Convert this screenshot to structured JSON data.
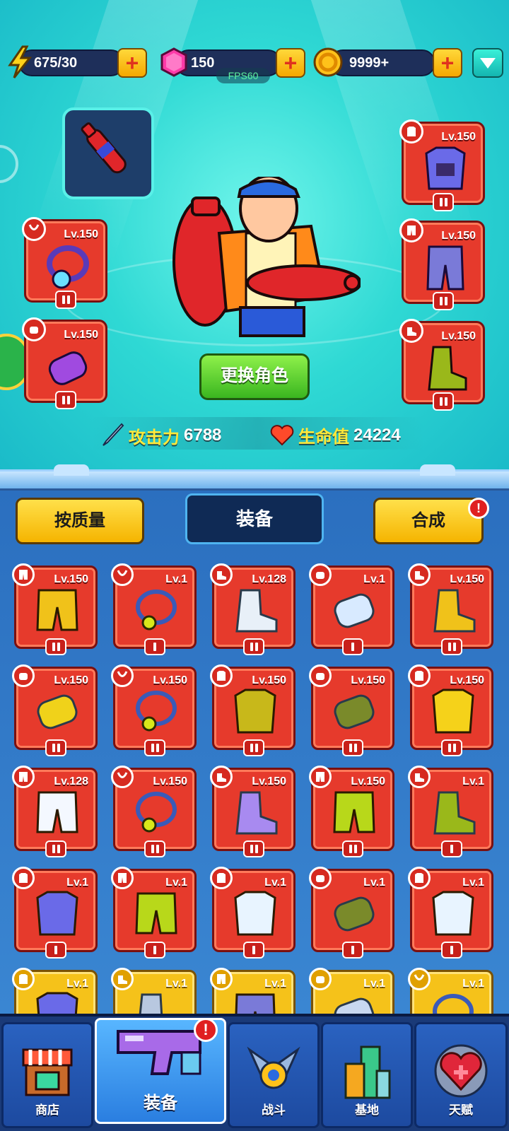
{
  "resources": {
    "energy": "675/30",
    "gems": "150",
    "coins": "9999+",
    "fps": "FPS60"
  },
  "hero_panel": {
    "change_character_label": "更换角色",
    "attack_label": "攻击力",
    "attack_value": "6788",
    "hp_label": "生命值",
    "hp_value": "24224",
    "left_slots": [
      {
        "level": "Lv.150",
        "type": "necklace"
      },
      {
        "level": "Lv.150",
        "type": "glove"
      }
    ],
    "right_slots": [
      {
        "level": "Lv.150",
        "type": "armor"
      },
      {
        "level": "Lv.150",
        "type": "pants"
      },
      {
        "level": "Lv.150",
        "type": "boots"
      }
    ]
  },
  "inventory_header": {
    "sort_label": "按质量",
    "tab_label": "装备",
    "merge_label": "合成",
    "alert": "!"
  },
  "inventory": [
    {
      "level": "Lv.150",
      "type": "pants",
      "item": "yellow-shorts"
    },
    {
      "level": "Lv.1",
      "type": "necklace",
      "item": "blue-necklace"
    },
    {
      "level": "Lv.128",
      "type": "boots",
      "item": "white-sock"
    },
    {
      "level": "Lv.1",
      "type": "glove",
      "item": "white-glove"
    },
    {
      "level": "Lv.150",
      "type": "boots",
      "item": "yellow-slipper"
    },
    {
      "level": "Lv.150",
      "type": "glove",
      "item": "yellow-glove"
    },
    {
      "level": "Lv.150",
      "type": "necklace",
      "item": "tag-necklace"
    },
    {
      "level": "Lv.150",
      "type": "armor",
      "item": "yellow-vest"
    },
    {
      "level": "Lv.150",
      "type": "glove",
      "item": "green-gauntlet"
    },
    {
      "level": "Lv.150",
      "type": "armor",
      "item": "hawaiian-shirt"
    },
    {
      "level": "Lv.128",
      "type": "pants",
      "item": "white-briefs"
    },
    {
      "level": "Lv.150",
      "type": "necklace",
      "item": "scarf"
    },
    {
      "level": "Lv.150",
      "type": "boots",
      "item": "purple-boot"
    },
    {
      "level": "Lv.150",
      "type": "pants",
      "item": "green-pants"
    },
    {
      "level": "Lv.1",
      "type": "boots",
      "item": "green-boot"
    },
    {
      "level": "Lv.1",
      "type": "armor",
      "item": "purple-armor"
    },
    {
      "level": "Lv.1",
      "type": "pants",
      "item": "green-pants"
    },
    {
      "level": "Lv.1",
      "type": "armor",
      "item": "white-tank"
    },
    {
      "level": "Lv.1",
      "type": "glove",
      "item": "green-gauntlet"
    },
    {
      "level": "Lv.1",
      "type": "armor",
      "item": "white-tank"
    },
    {
      "level": "Lv.1",
      "type": "armor",
      "item": "purple-armor",
      "rarity": "gold"
    },
    {
      "level": "Lv.1",
      "type": "boots",
      "item": "sock",
      "rarity": "gold"
    },
    {
      "level": "Lv.1",
      "type": "pants",
      "item": "purple-pants",
      "rarity": "gold"
    },
    {
      "level": "Lv.1",
      "type": "glove",
      "item": "glove",
      "rarity": "gold"
    },
    {
      "level": "Lv.1",
      "type": "necklace",
      "item": "necklace",
      "rarity": "gold"
    }
  ],
  "nav": [
    {
      "label": "商店",
      "icon": "shop-icon"
    },
    {
      "label": "装备",
      "icon": "equipment-gun-icon",
      "active": true,
      "alert": "!"
    },
    {
      "label": "战斗",
      "icon": "battle-icon"
    },
    {
      "label": "基地",
      "icon": "base-icon"
    },
    {
      "label": "天赋",
      "icon": "talent-heart-icon"
    }
  ],
  "colors": {
    "slot_red": "#e63a2c",
    "slot_gold": "#f5c21a",
    "accent_yellow": "#ffe04a",
    "teal_bg": "#2fd9d4"
  }
}
